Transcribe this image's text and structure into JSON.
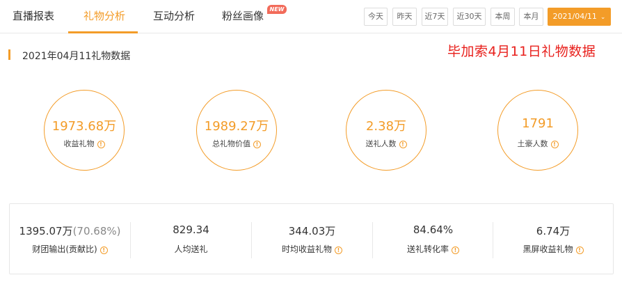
{
  "tabs": [
    {
      "label": "直播报表",
      "active": false
    },
    {
      "label": "礼物分析",
      "active": true
    },
    {
      "label": "互动分析",
      "active": false
    },
    {
      "label": "粉丝画像",
      "active": false,
      "badge": "NEW"
    }
  ],
  "date_filters": [
    "今天",
    "昨天",
    "近7天",
    "近30天",
    "本周",
    "本月"
  ],
  "date_picker": {
    "value": "2021/04/11"
  },
  "section": {
    "title": "2021年04月11礼物数据"
  },
  "annotation": "毕加索4月11日礼物数据",
  "circles": [
    {
      "value": "1973.68万",
      "label": "收益礼物"
    },
    {
      "value": "1989.27万",
      "label": "总礼物价值"
    },
    {
      "value": "2.38万",
      "label": "送礼人数"
    },
    {
      "value": "1791",
      "label": "土豪人数"
    }
  ],
  "stats": [
    {
      "value": "1395.07万",
      "percent": "(70.68%)",
      "label": "财团输出(贡献比)",
      "info": true
    },
    {
      "value": "829.34",
      "label": "人均送礼",
      "info": false
    },
    {
      "value": "344.03万",
      "label": "时均收益礼物",
      "info": true
    },
    {
      "value": "84.64%",
      "label": "送礼转化率",
      "info": true
    },
    {
      "value": "6.74万",
      "label": "黑屏收益礼物",
      "info": true
    }
  ],
  "colors": {
    "accent": "#f39c28",
    "annotation": "#e8201c",
    "badge": "#f26b5a"
  }
}
